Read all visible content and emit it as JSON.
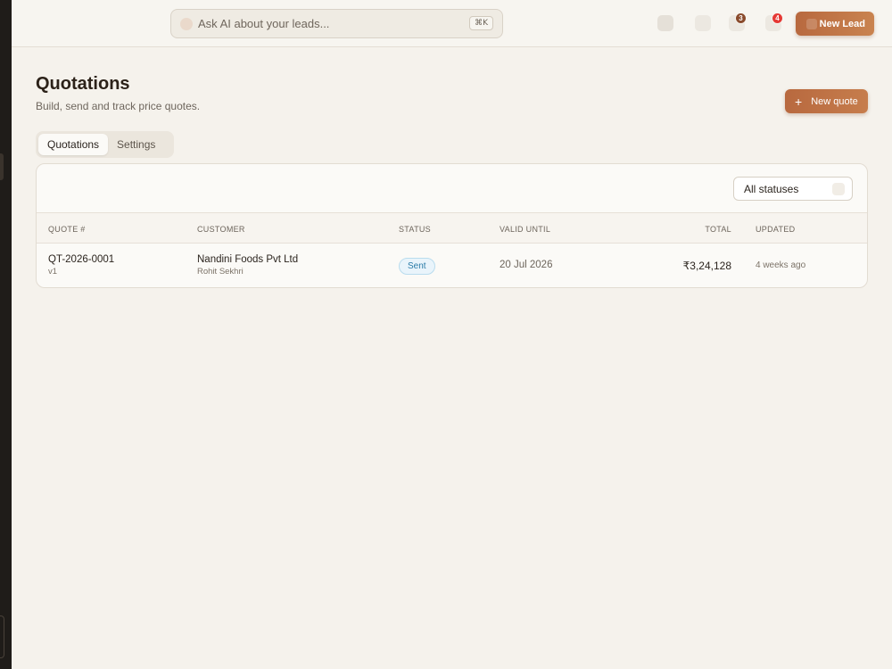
{
  "topbar": {
    "search_placeholder": "Ask AI about your leads...",
    "search_shortcut": "⌘K",
    "notifications_badge": "3",
    "alerts_badge": "4",
    "new_lead_label": "New Lead"
  },
  "header": {
    "title": "Quotations",
    "subtitle": "Build, send and track price quotes.",
    "new_quote_label": "New quote"
  },
  "tabs": [
    {
      "label": "Quotations",
      "active": true
    },
    {
      "label": "Settings",
      "active": false
    }
  ],
  "filter": {
    "status_value": "All statuses"
  },
  "table": {
    "columns": [
      "QUOTE #",
      "CUSTOMER",
      "STATUS",
      "VALID UNTIL",
      "TOTAL",
      "UPDATED"
    ],
    "rows": [
      {
        "quote_no": "QT-2026-0001",
        "version": "v1",
        "customer": "Nandini Foods Pvt Ltd",
        "contact": "Rohit Sekhri",
        "status": "Sent",
        "valid_until": "20 Jul 2026",
        "total": "₹3,24,128",
        "updated": "4 weeks ago"
      }
    ]
  },
  "colors": {
    "accent": "#b8693f",
    "badge_brown": "#8a4b2d",
    "badge_red": "#e53935",
    "status_sent": "#2a7ba8"
  }
}
